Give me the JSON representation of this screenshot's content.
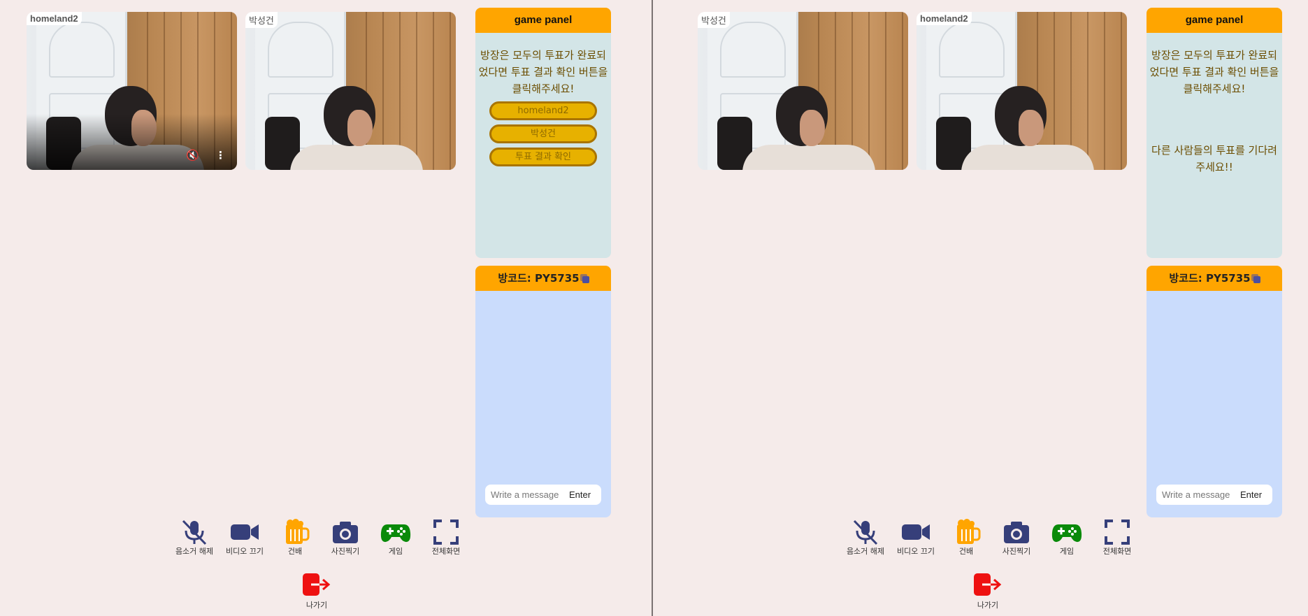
{
  "left": {
    "videos": [
      {
        "name": "homeland2",
        "muted": true
      },
      {
        "name": "박성건"
      }
    ],
    "game_panel": {
      "title": "game panel",
      "message": "방장은 모두의 투표가 완료되었다면 투표 결과 확인 버튼을 클릭해주세요!",
      "vote_options": [
        "homeland2",
        "박성건"
      ],
      "result_button": "투표 결과 확인"
    },
    "chat": {
      "room_code": "방코드: PY5735",
      "placeholder": "Write a message",
      "send_label": "Enter"
    }
  },
  "right": {
    "videos": [
      {
        "name": "박성건"
      },
      {
        "name": "homeland2"
      }
    ],
    "game_panel": {
      "title": "game panel",
      "message": "방장은 모두의 투표가 완료되었다면 투표 결과 확인 버튼을 클릭해주세요!",
      "wait_message": "다른 사람들의 투표를 기다려 주세요!!"
    },
    "chat": {
      "room_code": "방코드: PY5735",
      "placeholder": "Write a message",
      "send_label": "Enter"
    }
  },
  "toolbar": {
    "unmute": "음소거 해제",
    "video_off": "비디오 끄기",
    "cheers": "건배",
    "photo": "사진찍기",
    "game": "게임",
    "fullscreen": "전체화면",
    "exit": "나가기"
  },
  "colors": {
    "background": "#f5ebea",
    "accent_orange": "#ffa500",
    "navy_icon": "#363f7a",
    "game_green": "#0a8a0a",
    "exit_red": "#ee1111"
  }
}
